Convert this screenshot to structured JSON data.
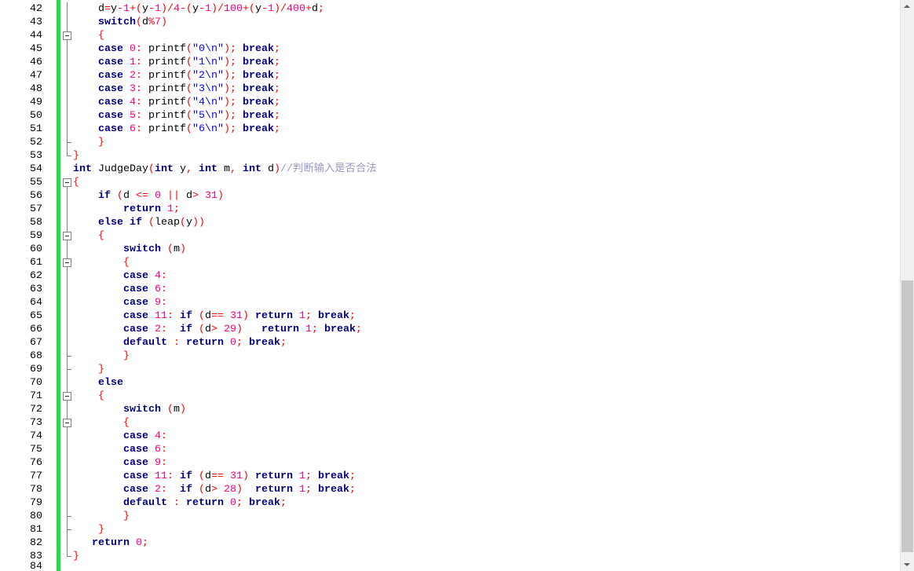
{
  "editor": {
    "lines": [
      {
        "number": "42",
        "code": "    d=y-1+(y-1)/4-(y-1)/100+(y-1)/400+d;",
        "fold": "line"
      },
      {
        "number": "43",
        "code": "    switch(d%7)",
        "fold": "line"
      },
      {
        "number": "44",
        "code": "    {",
        "fold": "nested-start"
      },
      {
        "number": "45",
        "code": "    case 0: printf(\"0\\n\"); break;",
        "fold": "line"
      },
      {
        "number": "46",
        "code": "    case 1: printf(\"1\\n\"); break;",
        "fold": "line"
      },
      {
        "number": "47",
        "code": "    case 2: printf(\"2\\n\"); break;",
        "fold": "line"
      },
      {
        "number": "48",
        "code": "    case 3: printf(\"3\\n\"); break;",
        "fold": "line"
      },
      {
        "number": "49",
        "code": "    case 4: printf(\"4\\n\"); break;",
        "fold": "line"
      },
      {
        "number": "50",
        "code": "    case 5: printf(\"5\\n\"); break;",
        "fold": "line"
      },
      {
        "number": "51",
        "code": "    case 6: printf(\"6\\n\"); break;",
        "fold": "line"
      },
      {
        "number": "52",
        "code": "    }",
        "fold": "nested-end"
      },
      {
        "number": "53",
        "code": "}",
        "fold": "end"
      },
      {
        "number": "54",
        "code": "int JudgeDay(int y, int m, int d)//判断输入是否合法",
        "fold": "none"
      },
      {
        "number": "55",
        "code": "{",
        "fold": "start"
      },
      {
        "number": "56",
        "code": "    if (d <= 0 || d> 31)",
        "fold": "line"
      },
      {
        "number": "57",
        "code": "        return 1;",
        "fold": "line"
      },
      {
        "number": "58",
        "code": "    else if (leap(y))",
        "fold": "line"
      },
      {
        "number": "59",
        "code": "    {",
        "fold": "nested-start"
      },
      {
        "number": "60",
        "code": "        switch (m)",
        "fold": "line"
      },
      {
        "number": "61",
        "code": "        {",
        "fold": "nested-start"
      },
      {
        "number": "62",
        "code": "        case 4:",
        "fold": "line"
      },
      {
        "number": "63",
        "code": "        case 6:",
        "fold": "line"
      },
      {
        "number": "64",
        "code": "        case 9:",
        "fold": "line"
      },
      {
        "number": "65",
        "code": "        case 11: if (d== 31) return 1; break;",
        "fold": "line"
      },
      {
        "number": "66",
        "code": "        case 2:  if (d> 29)   return 1; break;",
        "fold": "line"
      },
      {
        "number": "67",
        "code": "        default : return 0; break;",
        "fold": "line"
      },
      {
        "number": "68",
        "code": "        }",
        "fold": "nested-end"
      },
      {
        "number": "69",
        "code": "    }",
        "fold": "nested-end"
      },
      {
        "number": "70",
        "code": "    else",
        "fold": "line"
      },
      {
        "number": "71",
        "code": "    {",
        "fold": "nested-start"
      },
      {
        "number": "72",
        "code": "        switch (m)",
        "fold": "line"
      },
      {
        "number": "73",
        "code": "        {",
        "fold": "nested-start"
      },
      {
        "number": "74",
        "code": "        case 4:",
        "fold": "line"
      },
      {
        "number": "75",
        "code": "        case 6:",
        "fold": "line"
      },
      {
        "number": "76",
        "code": "        case 9:",
        "fold": "line"
      },
      {
        "number": "77",
        "code": "        case 11: if (d== 31) return 1; break;",
        "fold": "line"
      },
      {
        "number": "78",
        "code": "        case 2:  if (d> 28)  return 1; break;",
        "fold": "line"
      },
      {
        "number": "79",
        "code": "        default : return 0; break;",
        "fold": "line"
      },
      {
        "number": "80",
        "code": "        }",
        "fold": "nested-end"
      },
      {
        "number": "81",
        "code": "    }",
        "fold": "nested-end"
      },
      {
        "number": "82",
        "code": "   return 0;",
        "fold": "line"
      },
      {
        "number": "83",
        "code": "}",
        "fold": "end"
      },
      {
        "number": "84",
        "code": "",
        "fold": "none"
      }
    ]
  },
  "vertical_scrollbar": {
    "visible_fraction": 0.5,
    "scroll_position": 0.98
  },
  "colors": {
    "change_bar": "#22DD44",
    "keyword": "#00007F",
    "identifier": "#000000",
    "number": "#FF0080",
    "string": "#0000FF",
    "operator": "#FF0000",
    "comment": "#9898C8",
    "line_number": "#000000",
    "fold_marker": "#808080",
    "scroll_thumb": "#C8C8C8"
  }
}
